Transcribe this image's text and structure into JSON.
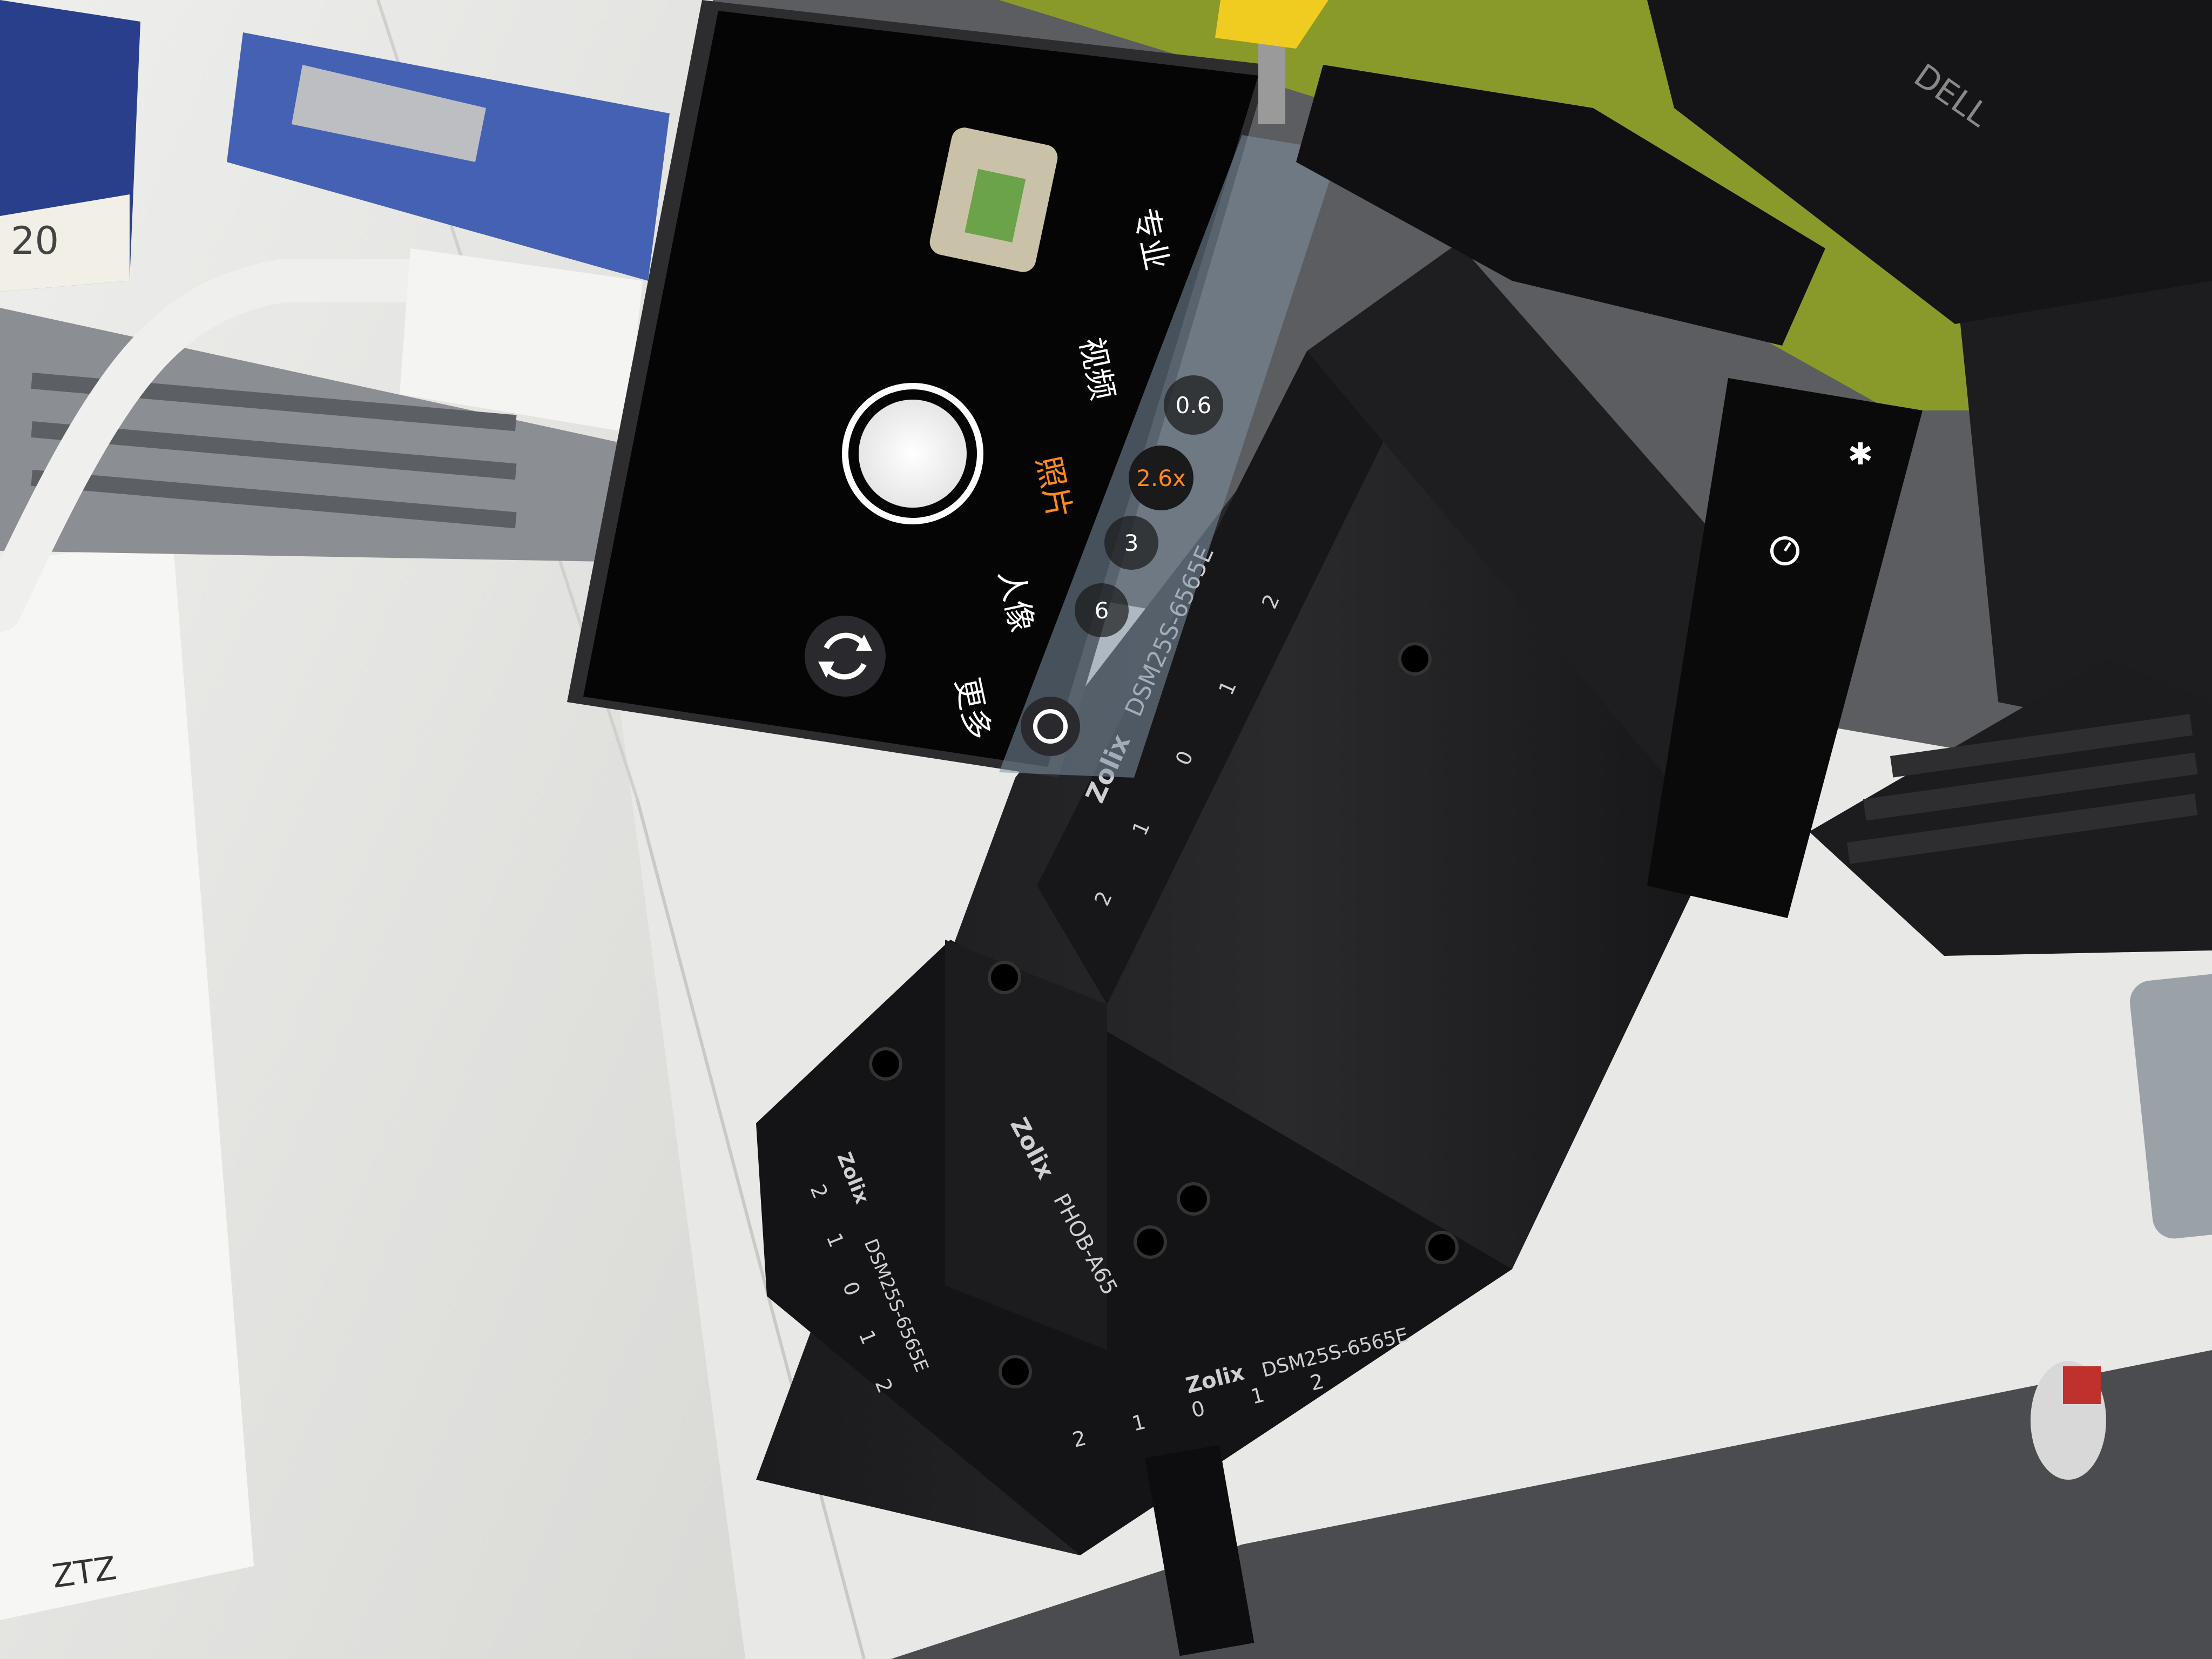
{
  "camera_ui": {
    "modes": [
      "专业",
      "视频",
      "照片",
      "人像",
      "更多"
    ],
    "active_mode": "照片",
    "zoom_levels": [
      "0.6",
      "2.6x",
      "3",
      "6"
    ],
    "active_zoom": "2.6x",
    "top_icons": [
      "flash-icon",
      "timer-icon"
    ],
    "accent_color": "#ff8a1c"
  },
  "stage_labels": {
    "brand": "Zolix",
    "model_upper": "DSM25S-6565E",
    "model_holder": "PHOB-A65",
    "model_lower": "DSM25S-6565E",
    "model_side": "DSM25S-6565E",
    "scale_upper": [
      "2",
      "1",
      "0",
      "1",
      "2"
    ],
    "scale_lower": [
      "2",
      "1",
      "0",
      "1",
      "2"
    ],
    "scale_side": [
      "2",
      "1",
      "0",
      "1",
      "2"
    ]
  },
  "misc_text": {
    "box_label": "20",
    "monitor_brand": "DELL",
    "note_text": "ZTZ"
  }
}
